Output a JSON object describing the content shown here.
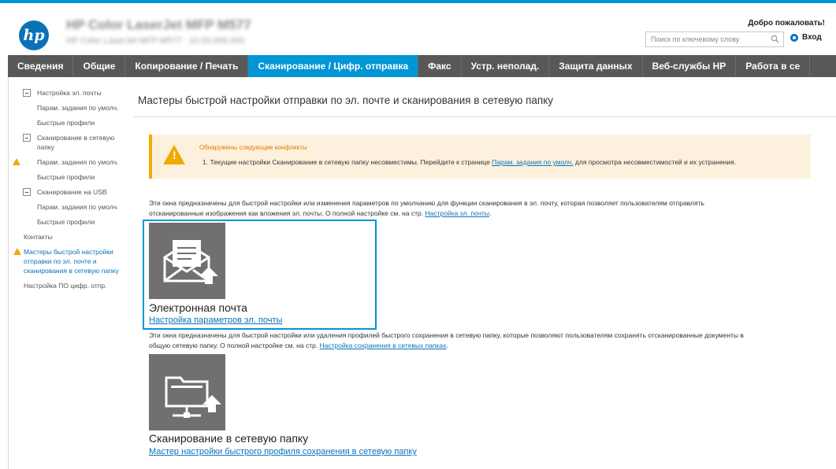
{
  "header": {
    "logo": "hp",
    "device_title": "HP Color LaserJet MFP M577",
    "device_subtitle": "HP Color LaserJet MFP M577 · 10.00.000.000",
    "welcome": "Добро пожаловать!",
    "search_placeholder": "Поиск по ключевому слову",
    "login_label": "Вход"
  },
  "nav": {
    "tabs": [
      {
        "label": "Сведения",
        "active": false
      },
      {
        "label": "Общие",
        "active": false
      },
      {
        "label": "Копирование / Печать",
        "active": false
      },
      {
        "label": "Сканирование / Цифр. отправка",
        "active": true
      },
      {
        "label": "Факс",
        "active": false
      },
      {
        "label": "Устр. неполад.",
        "active": false
      },
      {
        "label": "Защита данных",
        "active": false
      },
      {
        "label": "Веб-службы HP",
        "active": false
      },
      {
        "label": "Работа в се",
        "active": false
      }
    ]
  },
  "sidebar": {
    "items": [
      {
        "label": "Настройка эл. почты"
      },
      {
        "label": "Парам. задания по умолч."
      },
      {
        "label": "Быстрые профили"
      },
      {
        "label": "Сканирование в сетевую папку"
      },
      {
        "label": "Парам. задания по умолч."
      },
      {
        "label": "Быстрые профили"
      },
      {
        "label": "Сканирование на USB"
      },
      {
        "label": "Парам. задания по умолч."
      },
      {
        "label": "Быстрые профили"
      },
      {
        "label": "Контакты"
      },
      {
        "label": "Мастеры быстрой настройки отправки по эл. почте и сканирования в сетевую папку"
      },
      {
        "label": "Настройка ПО цифр. отпр."
      }
    ]
  },
  "main": {
    "title": "Мастеры быстрой настройки отправки по эл. почте и сканирования в сетевую папку",
    "alert": {
      "heading": "Обнаружены следующие конфликты",
      "line_prefix": "1.  Текущие настройки Сканирование в сетевую папку несовместимы. Перейдите к странице ",
      "line_link": "Парам. задания по умолч.",
      "line_suffix": " для просмотра несовместимостей и их устранения."
    },
    "email_desc_1": "Эти окна предназначены для быстрой настройки или изменения параметров по умолчанию для функции сканирования в эл. почту, которая позволяет пользователям отправлять",
    "email_desc_2": "отсканированные изображения как вложения эл. почты. О полной настройке см. на стр. ",
    "email_desc_link": "Настройка эл. почты",
    "email_card_name": "Электронная почта",
    "email_card_link": "Настройка параметров эл. почты",
    "folder_desc_1": "Эти окна предназначены для быстрой настройки или удаления профилей быстрого сохранения в сетевую папку, которые позволяют пользователям сохранять отсканированные документы в",
    "folder_desc_2": "общую сетевую папку. О полной настройке см. на стр. ",
    "folder_desc_link": "Настройка сохранения в сетевых папках",
    "folder_card_name": "Сканирование в сетевую папку",
    "folder_card_link": "Мастер настройки быстрого профиля сохранения в сетевую папку"
  },
  "colors": {
    "accent": "#0096d6",
    "nav_bg": "#585858",
    "warning": "#f2a900",
    "alert_bg": "#fdf1dd",
    "link": "#0a73b8"
  }
}
